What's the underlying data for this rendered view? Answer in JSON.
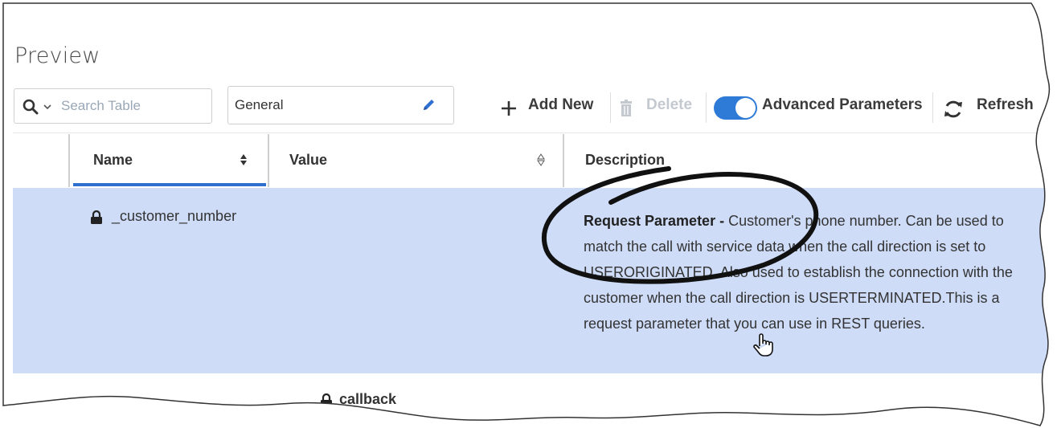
{
  "panel": {
    "title": "Preview"
  },
  "toolbar": {
    "search_placeholder": "Search Table",
    "group_select_value": "General",
    "add_new_label": "Add New",
    "delete_label": "Delete",
    "advanced_label": "Advanced Parameters",
    "advanced_enabled": true,
    "refresh_label": "Refresh"
  },
  "table": {
    "columns": {
      "name": "Name",
      "value": "Value",
      "description": "Description"
    },
    "rows": [
      {
        "name": "_customer_number",
        "value": "",
        "description_bold": "Request Parameter -",
        "description_text": " Customer's phone number. Can be used to match the call with service data when the call direction is set to USERORIGINATED. Also used to establish the connection with the customer when the call direction is USERTERMINATED.This is a request parameter that you can use in REST queries.",
        "locked": true,
        "selected": true
      },
      {
        "name": "",
        "value": "callback",
        "locked": true,
        "selected": false
      }
    ]
  },
  "colors": {
    "accent": "#2e7bd7",
    "selected_row": "#cedcf8"
  },
  "icons": [
    "search-icon",
    "chevron-down-icon",
    "pencil-icon",
    "plus-icon",
    "trash-icon",
    "refresh-icon",
    "lock-icon",
    "sort-icon",
    "hand-cursor-icon"
  ]
}
